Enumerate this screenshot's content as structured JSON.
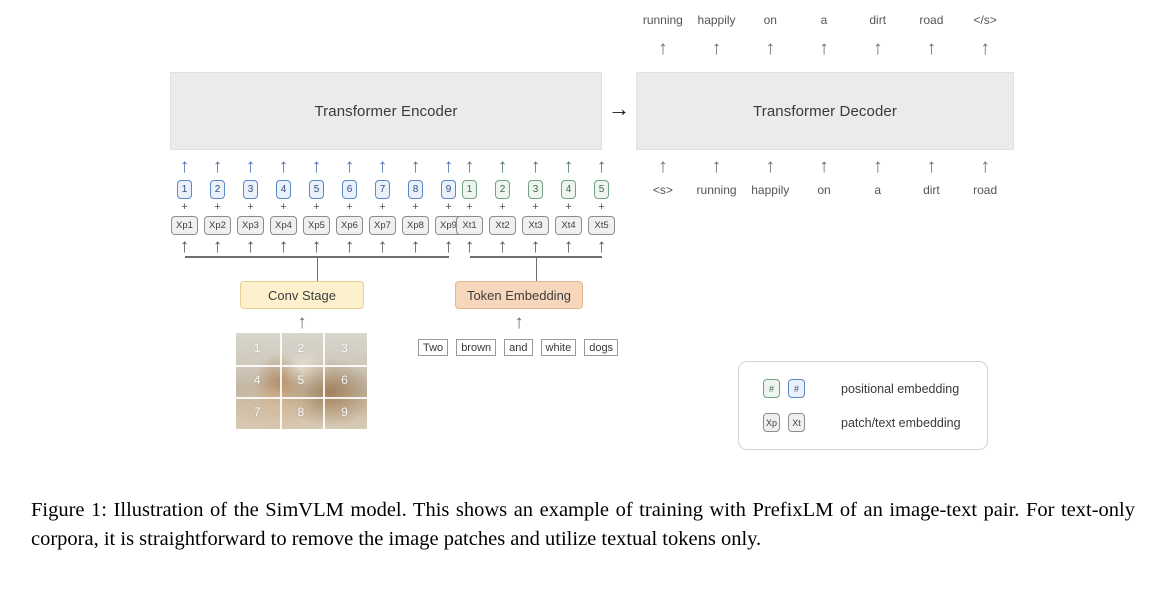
{
  "figure": {
    "encoder": {
      "label": "Transformer Encoder"
    },
    "decoder": {
      "label": "Transformer Decoder"
    },
    "flow_arrow": "→",
    "up_arrow": "↑",
    "plus": "+",
    "conv_stage": {
      "label": "Conv Stage"
    },
    "token_embedding": {
      "label": "Token Embedding"
    },
    "image_patches": {
      "numbers": [
        "1",
        "2",
        "3",
        "4",
        "5",
        "6",
        "7",
        "8",
        "9"
      ],
      "alt": "photo of two brown and white dogs running on a dirt road, split into a 3x3 patch grid"
    },
    "patch_positional": [
      "1",
      "2",
      "3",
      "4",
      "5",
      "6",
      "7",
      "8",
      "9"
    ],
    "patch_embeddings": [
      "Xp1",
      "Xp2",
      "Xp3",
      "Xp4",
      "Xp5",
      "Xp6",
      "Xp7",
      "Xp8",
      "Xp9"
    ],
    "text_positional": [
      "1",
      "2",
      "3",
      "4",
      "5"
    ],
    "text_embeddings": [
      "Xt1",
      "Xt2",
      "Xt3",
      "Xt4",
      "Xt5"
    ],
    "input_tokens": [
      "Two",
      "brown",
      "and",
      "white",
      "dogs"
    ],
    "decoder_outputs": [
      "running",
      "happily",
      "on",
      "a",
      "dirt",
      "road",
      "</s>"
    ],
    "decoder_inputs": [
      "<s>",
      "running",
      "happily",
      "on",
      "a",
      "dirt",
      "road"
    ],
    "legend": {
      "rows": [
        {
          "chips": [
            "#",
            "#"
          ],
          "label": "positional embedding"
        },
        {
          "chips": [
            "Xp",
            "Xt"
          ],
          "label": "patch/text embedding"
        }
      ]
    },
    "colors": {
      "block_fill": "#ebebeb",
      "patch_blue": "#5a87c5",
      "text_green": "#75a183",
      "conv_stage_fill": "#fcf0cd",
      "token_embedding_fill": "#f7d7bb",
      "line_gray": "#6f6f6f"
    }
  },
  "caption": {
    "text": "Figure 1: Illustration of the SimVLM model. This shows an example of training with PrefixLM of an image-text pair. For text-only corpora, it is straightforward to remove the image patches and utilize textual tokens only."
  }
}
